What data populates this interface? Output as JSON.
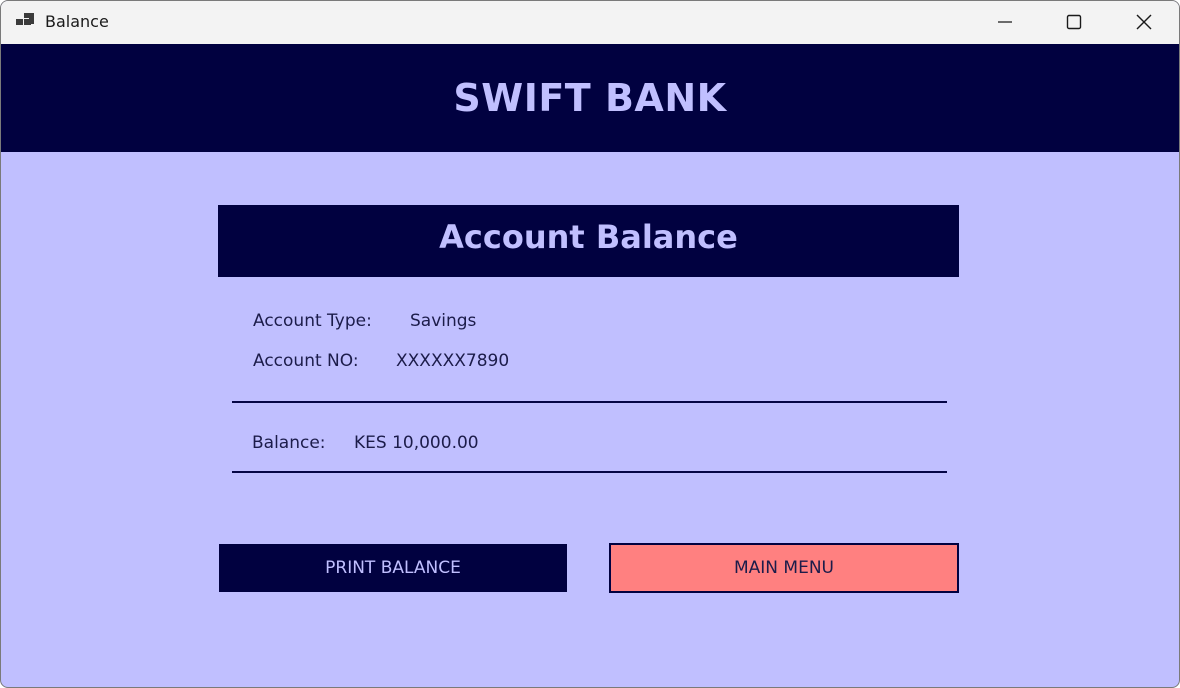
{
  "window": {
    "title": "Balance",
    "icon": "app-window-icon",
    "controls": [
      "minimize-icon",
      "maximize-icon",
      "close-icon"
    ]
  },
  "header": {
    "brand": "SWIFT BANK"
  },
  "card": {
    "title": "Account Balance",
    "account_type_label": "Account Type:",
    "account_type_value": "Savings",
    "account_no_label": "Account NO:",
    "account_no_value": "XXXXXX7890",
    "balance_label": "Balance:",
    "balance_value": "KES 10,000.00"
  },
  "actions": {
    "print_label": "PRINT BALANCE",
    "menu_label": "MAIN MENU"
  },
  "colors": {
    "background": "#c0bfff",
    "navy": "#010140",
    "accent_text": "#c0bfff",
    "menu_button": "#ff8080"
  }
}
